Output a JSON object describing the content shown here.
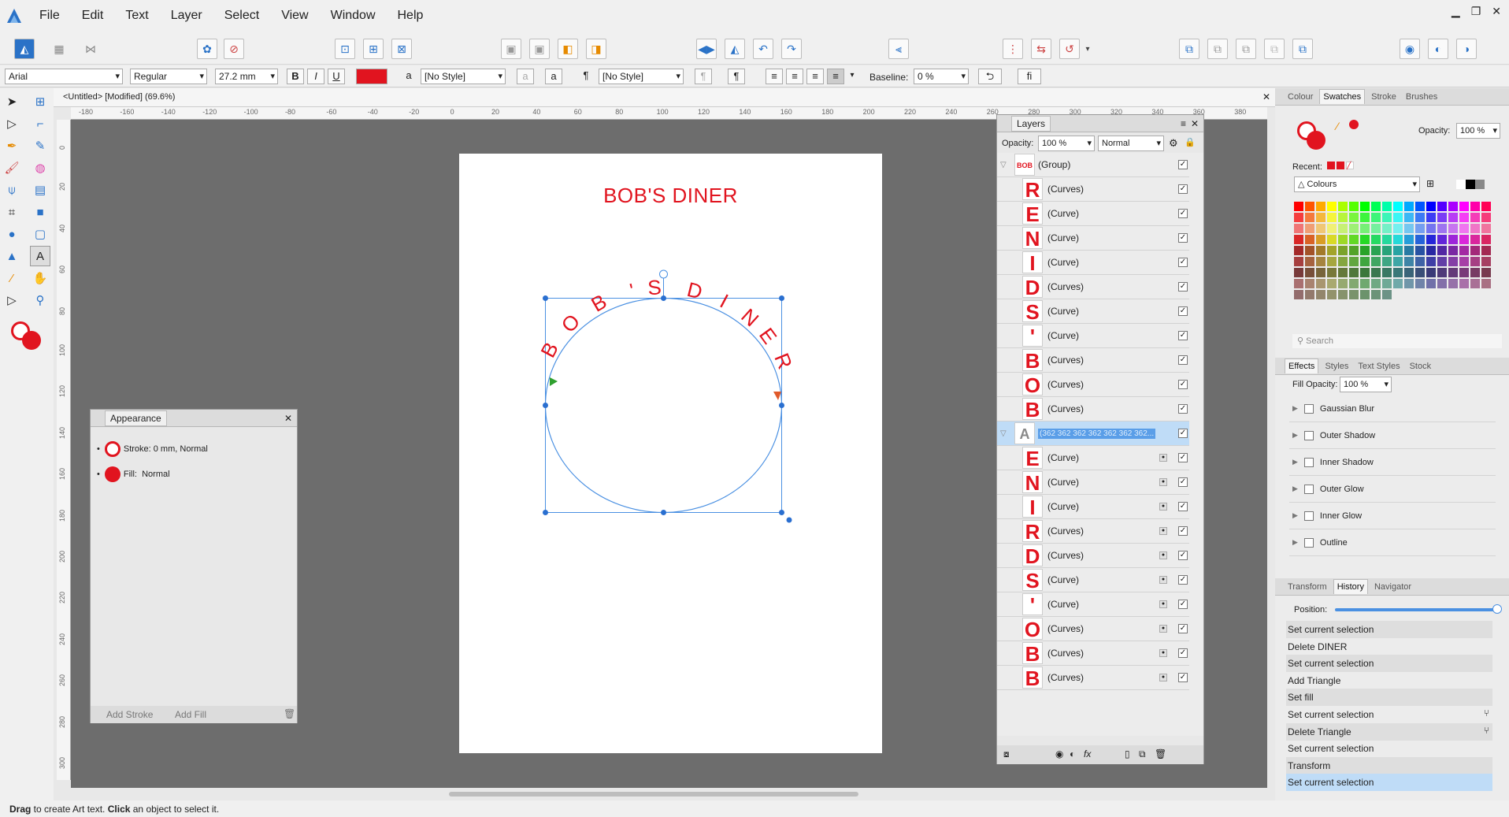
{
  "menu": {
    "items": [
      "File",
      "Edit",
      "Text",
      "Layer",
      "Select",
      "View",
      "Window",
      "Help"
    ]
  },
  "context": {
    "font": "Arial",
    "style": "Regular",
    "size": "27.2 mm",
    "para_style": "[No Style]",
    "char_style": "[No Style]",
    "baseline_label": "Baseline:",
    "baseline_value": "0 %",
    "fill_color": "#e1141f"
  },
  "doc": {
    "tab_title": "<Untitled> [Modified] (69.6%)"
  },
  "canvas": {
    "title": "BOB'S DINER",
    "arc_letters": [
      "B",
      "O",
      "B",
      "'",
      "S",
      "D",
      "I",
      "N",
      "E",
      "R"
    ],
    "text_color": "#e1141f"
  },
  "ruler": {
    "h_ticks": [
      "-180",
      "-160",
      "-140",
      "-120",
      "-100",
      "-80",
      "-60",
      "-40",
      "-20",
      "0",
      "20",
      "40",
      "60",
      "80",
      "100",
      "120",
      "140",
      "160",
      "180",
      "200",
      "220",
      "240",
      "260",
      "280",
      "300",
      "320",
      "340",
      "360",
      "380",
      "40"
    ],
    "v_ticks": [
      "0",
      "20",
      "40",
      "60",
      "80",
      "100",
      "120",
      "140",
      "160",
      "180",
      "200",
      "220",
      "240",
      "260",
      "280",
      "300"
    ]
  },
  "appearance": {
    "title": "Appearance",
    "stroke": "Stroke: 0 mm,",
    "stroke_mode": "Normal",
    "fill": "Fill:",
    "fill_mode": "Normal",
    "add_stroke": "Add Stroke",
    "add_fill": "Add Fill"
  },
  "layers": {
    "title": "Layers",
    "opacity_label": "Opacity:",
    "opacity": "100 %",
    "blend": "Normal",
    "group1": {
      "name": "(Group)",
      "rows": [
        {
          "glyph": "R",
          "name": "(Curves)"
        },
        {
          "glyph": "E",
          "name": "(Curve)"
        },
        {
          "glyph": "N",
          "name": "(Curve)"
        },
        {
          "glyph": "I",
          "name": "(Curve)"
        },
        {
          "glyph": "D",
          "name": "(Curves)"
        },
        {
          "glyph": "S",
          "name": "(Curve)"
        },
        {
          "glyph": "'",
          "name": "(Curve)"
        },
        {
          "glyph": "B",
          "name": "(Curves)"
        },
        {
          "glyph": "O",
          "name": "(Curves)"
        },
        {
          "glyph": "B",
          "name": "(Curves)"
        }
      ]
    },
    "group2": {
      "name": "(362 362 362 362 362 362 362...",
      "rows": [
        {
          "glyph": "E",
          "name": "(Curve)"
        },
        {
          "glyph": "N",
          "name": "(Curve)"
        },
        {
          "glyph": "I",
          "name": "(Curve)"
        },
        {
          "glyph": "R",
          "name": "(Curves)"
        },
        {
          "glyph": "D",
          "name": "(Curves)"
        },
        {
          "glyph": "S",
          "name": "(Curve)"
        },
        {
          "glyph": "'",
          "name": "(Curve)"
        },
        {
          "glyph": "O",
          "name": "(Curves)"
        },
        {
          "glyph": "B",
          "name": "(Curves)"
        },
        {
          "glyph": "B",
          "name": "(Curves)"
        }
      ]
    }
  },
  "swatches": {
    "tabs": [
      "Colour",
      "Swatches",
      "Stroke",
      "Brushes"
    ],
    "active": "Swatches",
    "opacity_label": "Opacity:",
    "opacity": "100 %",
    "recent_label": "Recent:",
    "palette": "Colours",
    "search_placeholder": "Search"
  },
  "effects": {
    "tabs": [
      "Effects",
      "Styles",
      "Text Styles",
      "Stock"
    ],
    "active": "Effects",
    "fill_opacity_label": "Fill Opacity:",
    "fill_opacity": "100 %",
    "items": [
      "Gaussian Blur",
      "Outer Shadow",
      "Inner Shadow",
      "Outer Glow",
      "Inner Glow",
      "Outline"
    ]
  },
  "history": {
    "tabs": [
      "Transform",
      "History",
      "Navigator"
    ],
    "active": "History",
    "position_label": "Position:",
    "items": [
      "Set current selection",
      "Delete DINER",
      "Set current selection",
      "Add Triangle",
      "Set fill",
      "Set current selection",
      "Delete Triangle",
      "Set current selection",
      "Transform",
      "Set current selection"
    ]
  },
  "status": {
    "bold1": "Drag",
    "text1": " to create Art text. ",
    "bold2": "Click",
    "text2": " an object to select it."
  }
}
